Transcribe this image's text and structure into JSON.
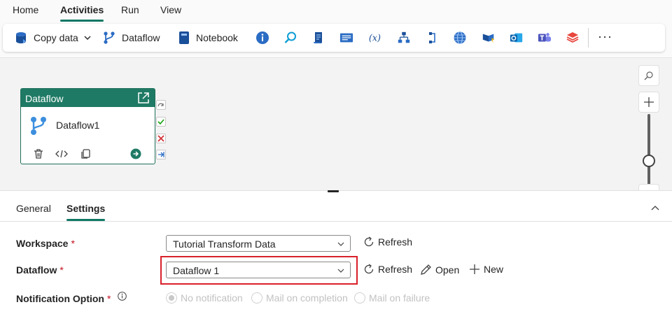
{
  "menu": {
    "tabs": [
      {
        "label": "Home"
      },
      {
        "label": "Activities"
      },
      {
        "label": "Run"
      },
      {
        "label": "View"
      }
    ],
    "active": "Activities"
  },
  "ribbon": {
    "copy_data": "Copy data",
    "dataflow": "Dataflow",
    "notebook": "Notebook",
    "more": "···"
  },
  "activity": {
    "type": "Dataflow",
    "name": "Dataflow1"
  },
  "panel": {
    "tabs": {
      "general": "General",
      "settings": "Settings"
    },
    "active": "Settings",
    "workspace": {
      "label": "Workspace",
      "required": "*",
      "value": "Tutorial Transform Data",
      "refresh": "Refresh"
    },
    "dataflow": {
      "label": "Dataflow",
      "required": "*",
      "value": "Dataflow 1",
      "refresh": "Refresh",
      "open": "Open",
      "new": "New"
    },
    "notification": {
      "label": "Notification Option",
      "required": "*",
      "options": [
        "No notification",
        "Mail on completion",
        "Mail on failure"
      ],
      "selected": "No notification"
    }
  },
  "colors": {
    "accent": "#117865",
    "activity_header": "#1f7a65",
    "highlight": "#d9202a",
    "required": "#c50f1f"
  }
}
